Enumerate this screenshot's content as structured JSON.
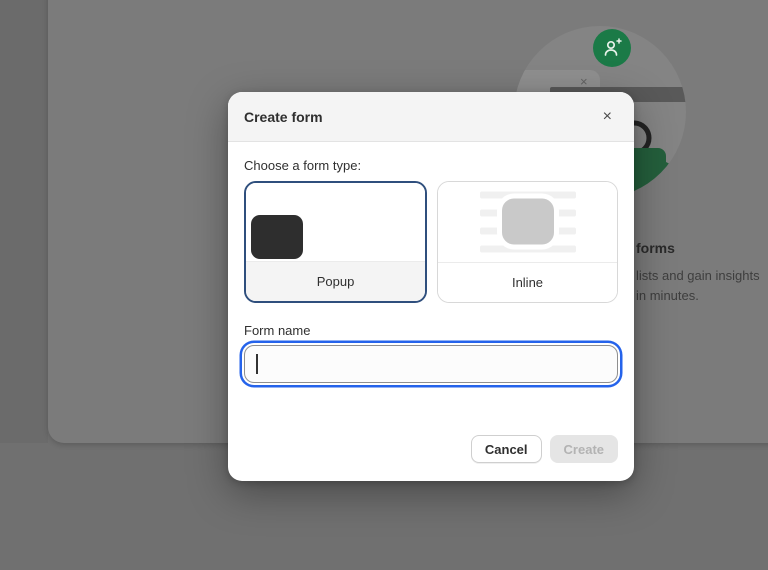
{
  "background": {
    "empty_state": {
      "heading_fragment": "forms",
      "line1_fragment": "lists and gain insights",
      "line2_fragment": "in minutes.",
      "mockup_close_glyph": "×"
    },
    "colors": {
      "page_dim": "#707070",
      "card_dim": "#7b7b7b",
      "circle": "#848484",
      "badge_green": "#1b7a47",
      "teapot_green": "#245f3c"
    }
  },
  "dialog": {
    "title": "Create form",
    "close_glyph": "×",
    "form_type_label": "Choose a form type:",
    "options": [
      {
        "label": "Popup",
        "selected": true
      },
      {
        "label": "Inline",
        "selected": false
      }
    ],
    "form_name_label": "Form name",
    "form_name_value": "",
    "cancel_label": "Cancel",
    "create_label": "Create",
    "colors": {
      "selected_border": "#2f4f7d",
      "focus_ring": "#2563eb"
    }
  }
}
